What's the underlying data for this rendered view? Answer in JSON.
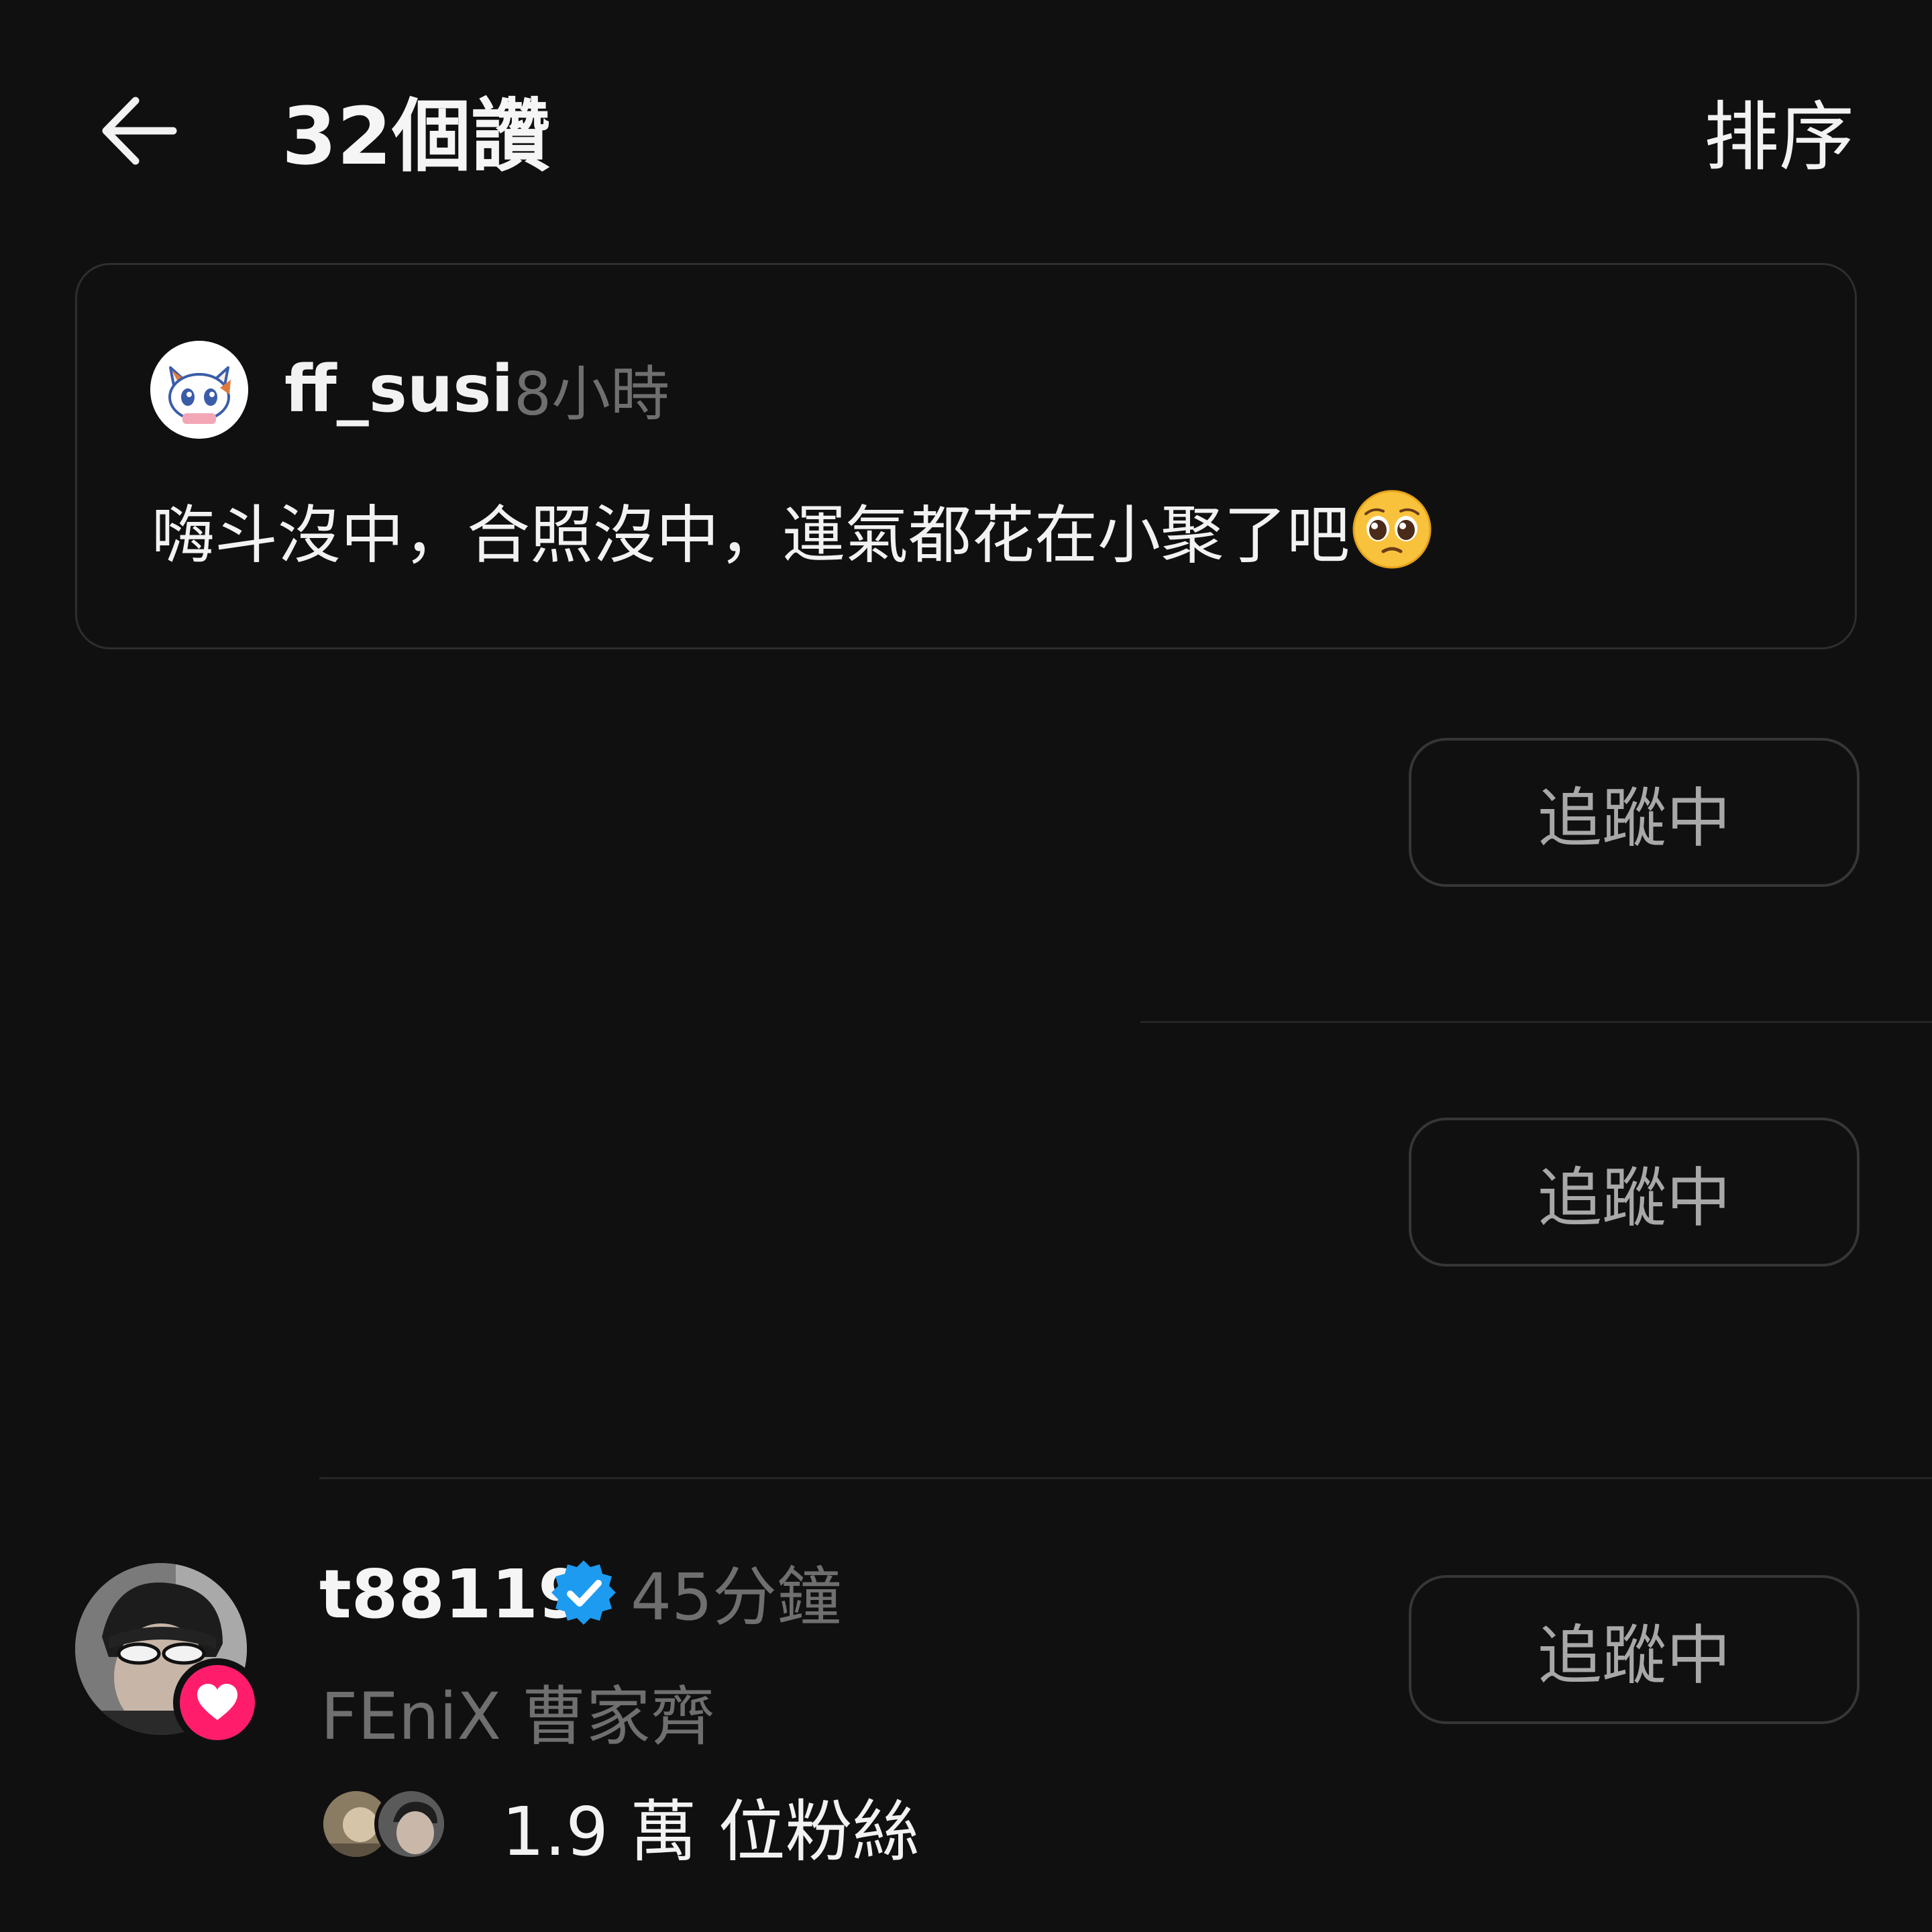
{
  "header": {
    "title": "32個讚",
    "sort_label": "排序"
  },
  "comment": {
    "username": "ff_susi",
    "time": "8小時",
    "text": "嗨斗沒中，合照沒中，運氣都花在小聚了吧",
    "emoji": "pleading-face-icon"
  },
  "rows": [
    {
      "follow_label": "追蹤中"
    },
    {
      "follow_label": "追蹤中"
    },
    {
      "username": "t88119",
      "verified": true,
      "time": "45分鐘",
      "full_name": "FEniX 曹家齊",
      "followers": "1.9 萬 位粉絲",
      "follow_label": "追蹤中"
    }
  ],
  "colors": {
    "background": "#101010",
    "like_badge": "#ff1d6b",
    "verified": "#1d9bf0",
    "secondary_text": "#6f6f6f"
  }
}
